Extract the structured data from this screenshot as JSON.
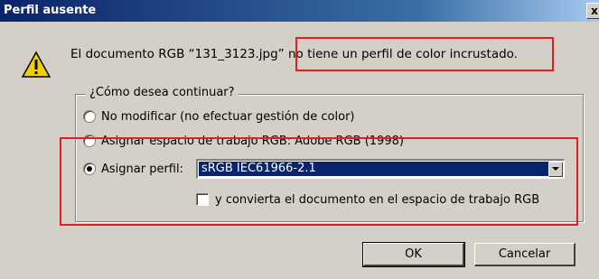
{
  "window": {
    "title": "Perfil ausente",
    "close_glyph": "x"
  },
  "message": {
    "prefix": "El documento RGB “131_3123.jpg”",
    "highlighted": "no tiene un perfil de color incrustado."
  },
  "icon": {
    "name": "warning-icon",
    "color": "#f0d000"
  },
  "group": {
    "legend": "¿Cómo desea continuar?",
    "options": [
      {
        "label": "No modificar (no efectuar gestión de color)",
        "checked": false
      },
      {
        "label": "Asignar espacio de trabajo RGB: Adobe RGB (1998)",
        "checked": false
      },
      {
        "label": "Asignar perfil:",
        "checked": true
      }
    ],
    "profile_select": {
      "value": "sRGB IEC61966-2.1"
    },
    "convert_checkbox": {
      "label": "y convierta el documento en el espacio de trabajo RGB",
      "checked": false
    }
  },
  "buttons": {
    "ok": "OK",
    "cancel": "Cancelar"
  },
  "colors": {
    "annotation_red": "#e02020",
    "titlebar": "#0a246a",
    "selection": "#0a246a"
  }
}
